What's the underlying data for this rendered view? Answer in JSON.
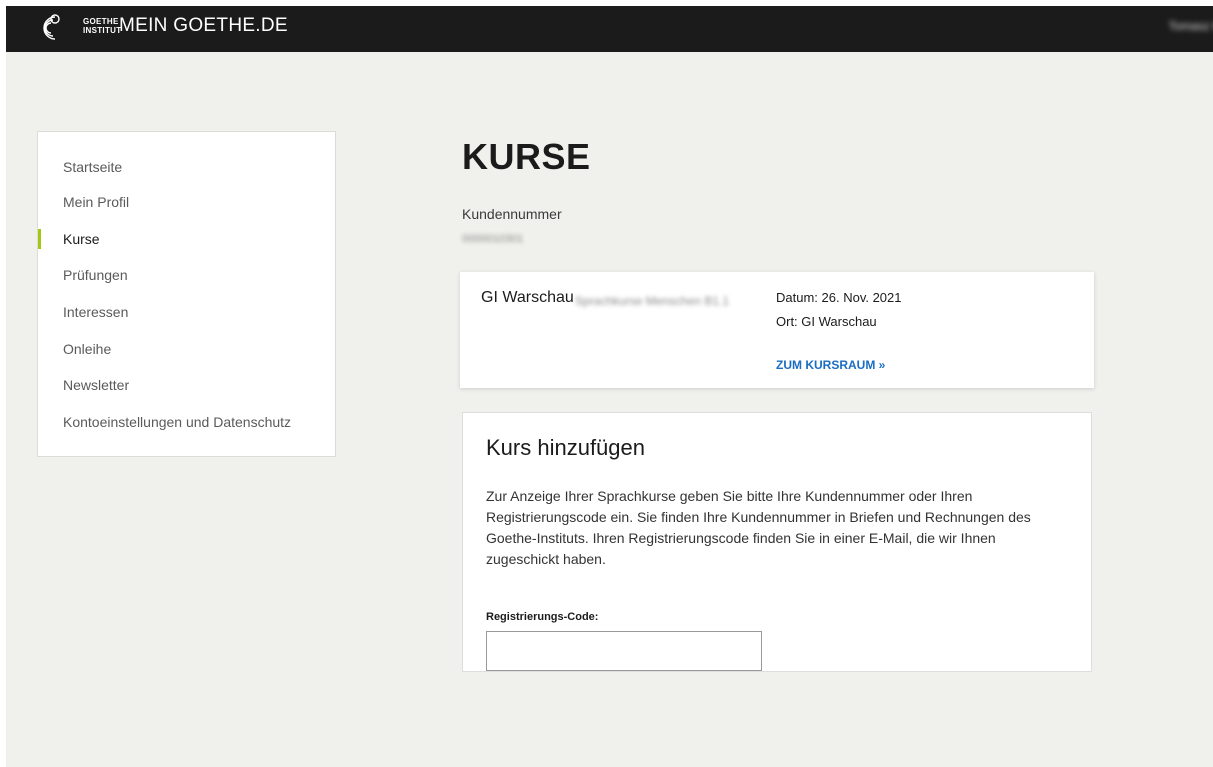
{
  "header": {
    "logo_line1": "GOETHE",
    "logo_line2": "INSTITUT",
    "app_title": "MEIN GOETHE.DE",
    "user_name": "Tomasz K"
  },
  "sidebar": {
    "items": [
      {
        "label": "Startseite",
        "active": false
      },
      {
        "label": "Mein Profil",
        "active": false
      },
      {
        "label": "Kurse",
        "active": true
      },
      {
        "label": "Prüfungen",
        "active": false
      },
      {
        "label": "Interessen",
        "active": false
      },
      {
        "label": "Onleihe",
        "active": false
      },
      {
        "label": "Newsletter",
        "active": false
      },
      {
        "label": "Kontoeinstellungen und Datenschutz",
        "active": false
      }
    ]
  },
  "main": {
    "title": "KURSE",
    "customer_label": "Kundennummer",
    "customer_value": "0000010301",
    "course": {
      "name": "GI Warschau",
      "extra": "Sprachkurse Menschen B1.1",
      "date": "Datum: 26. Nov. 2021",
      "place": "Ort: GI Warschau",
      "link": "ZUM KURSRAUM »"
    },
    "add_course": {
      "title": "Kurs hinzufügen",
      "text": "Zur Anzeige Ihrer Sprachkurse geben Sie bitte Ihre Kundennummer oder Ihren Registrierungscode ein. Sie finden Ihre Kundennummer in Briefen und Rechnungen des Goethe-Instituts. Ihren Registrierungscode finden Sie in einer E-Mail, die wir Ihnen zugeschickt haben.",
      "field_label": "Registrierungs-Code:",
      "field_value": ""
    }
  },
  "colors": {
    "topbar": "#1b1b1b",
    "background": "#f0f0ec",
    "accent": "#a0c814",
    "link": "#1a6dc2"
  }
}
